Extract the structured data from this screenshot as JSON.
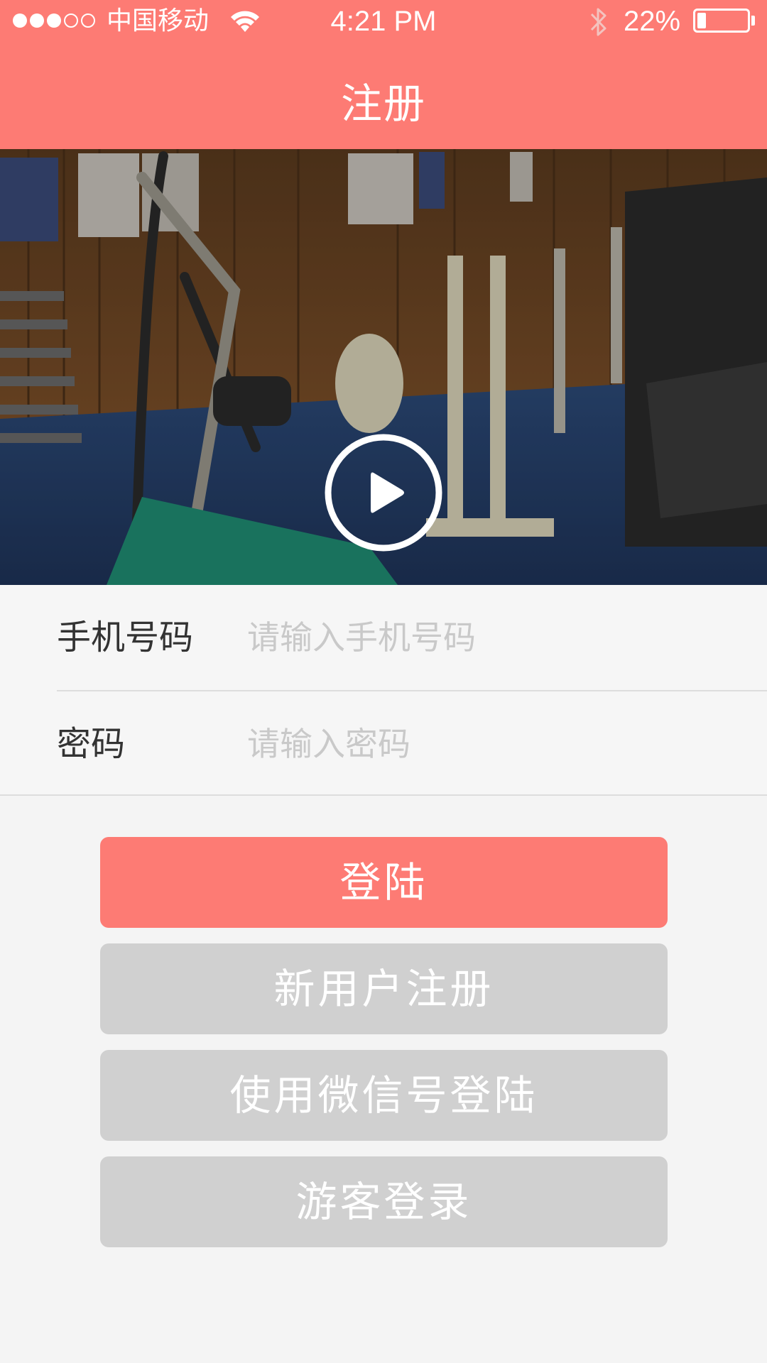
{
  "status_bar": {
    "carrier": "中国移动",
    "time": "4:21 PM",
    "battery_percent": "22%",
    "battery_level": 0.22,
    "signal_strength": 3,
    "signal_max": 5
  },
  "nav": {
    "title": "注册"
  },
  "banner": {
    "play_icon": "play-circle-icon"
  },
  "form": {
    "phone": {
      "label": "手机号码",
      "placeholder": "请输入手机号码",
      "value": ""
    },
    "password": {
      "label": "密码",
      "placeholder": "请输入密码",
      "value": ""
    }
  },
  "buttons": {
    "login": "登陆",
    "register": "新用户注册",
    "wechat_login": "使用微信号登陆",
    "guest_login": "游客登录"
  },
  "colors": {
    "accent": "#fd7b74",
    "secondary_button": "#d0d0d0",
    "background": "#f4f4f4",
    "placeholder": "#c9c9c9"
  }
}
